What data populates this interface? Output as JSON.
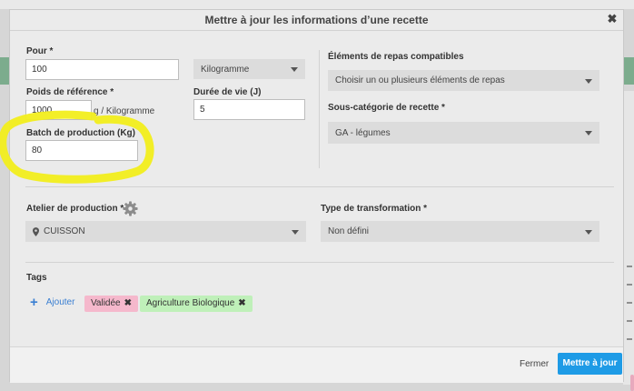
{
  "modal": {
    "title": "Mettre à jour les informations d’une recette",
    "close_symbol": "✖"
  },
  "form": {
    "pour": {
      "label": "Pour *",
      "value": "100",
      "unit_selected": "Kilogramme"
    },
    "poids_reference": {
      "label": "Poids de référence *",
      "value": "1000",
      "unit_text": "g /  Kilogramme"
    },
    "duree_de_vie": {
      "label": "Durée de vie (J)",
      "value": "5"
    },
    "batch_production": {
      "label": "Batch de production (Kg)",
      "value": "80"
    },
    "elements_repas": {
      "label": "Éléments de repas compatibles",
      "placeholder": "Choisir un ou plusieurs éléments de repas"
    },
    "sous_categorie": {
      "label": "Sous-catégorie de recette *",
      "selected": "GA - légumes"
    },
    "atelier": {
      "label": "Atelier de production *",
      "selected": "CUISSON"
    },
    "type_transformation": {
      "label": "Type de transformation *",
      "selected": "Non défini"
    },
    "tags": {
      "label": "Tags",
      "add_label": "Ajouter",
      "items": [
        {
          "label": "Validée",
          "color": "#f5b8cc"
        },
        {
          "label": "Agriculture Biologique",
          "color": "#bff0b9"
        }
      ]
    }
  },
  "footer": {
    "cancel_label": "Fermer",
    "submit_label": "Mettre à jour"
  },
  "colors": {
    "primary": "#1e9be6",
    "highlight": "#f2ee1c",
    "link": "#3a7fd2"
  },
  "icons": {
    "close": "close-icon",
    "gear": "gear-icon",
    "pin": "map-marker-icon",
    "add": "plus-icon",
    "caret": "chevron-down-icon"
  }
}
